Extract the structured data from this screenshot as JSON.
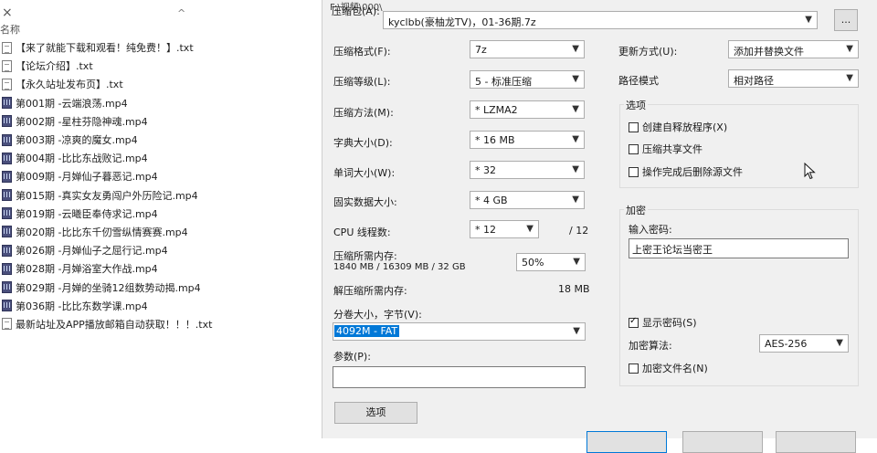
{
  "explorer": {
    "close_glyph": "×",
    "up_glyph": "^",
    "column_header": "名称",
    "files": [
      {
        "type": "txt",
        "name": "【来了就能下载和观看！纯免费！】.txt"
      },
      {
        "type": "txt",
        "name": "【论坛介绍】.txt"
      },
      {
        "type": "txt",
        "name": "【永久站址发布页】.txt"
      },
      {
        "type": "mp4",
        "name": "第001期 -云端浪荡.mp4"
      },
      {
        "type": "mp4",
        "name": "第002期 -星柱芬隐神魂.mp4"
      },
      {
        "type": "mp4",
        "name": "第003期 -凉爽的魔女.mp4"
      },
      {
        "type": "mp4",
        "name": "第004期 -比比东战败记.mp4"
      },
      {
        "type": "mp4",
        "name": "第009期 -月婵仙子暮恶记.mp4"
      },
      {
        "type": "mp4",
        "name": "第015期 -真实女友勇闯户外历险记.mp4"
      },
      {
        "type": "mp4",
        "name": "第019期 -云曦臣奉侍求记.mp4"
      },
      {
        "type": "mp4",
        "name": "第020期 -比比东千仞雪纵情赛赛.mp4"
      },
      {
        "type": "mp4",
        "name": "第026期 -月婵仙子之屈行记.mp4"
      },
      {
        "type": "mp4",
        "name": "第028期 -月婵浴室大作战.mp4"
      },
      {
        "type": "mp4",
        "name": "第029期 -月婵的坐骑12组数势动揭.mp4"
      },
      {
        "type": "mp4",
        "name": "第036期 -比比东数学课.mp4"
      },
      {
        "type": "txt",
        "name": "最新站址及APP播放邮箱自动获取！！！.txt"
      }
    ]
  },
  "dialog": {
    "archive_label": "压缩包(A):",
    "archive_path_hint": "F:\\视频\\000\\",
    "archive_name": "kyclbb(豪柚龙TV)，01-36期.7z",
    "browse_label": "...",
    "format": {
      "label": "压缩格式(F):",
      "value": "7z"
    },
    "level": {
      "label": "压缩等级(L):",
      "value": "5 - 标准压缩"
    },
    "method": {
      "label": "压缩方法(M):",
      "value": "* LZMA2"
    },
    "dict": {
      "label": "字典大小(D):",
      "value": "* 16 MB"
    },
    "word": {
      "label": "单词大小(W):",
      "value": "* 32"
    },
    "solid": {
      "label": "固实数据大小:",
      "value": "* 4 GB"
    },
    "cpu": {
      "label": "CPU 线程数:",
      "value": "* 12",
      "total": "/ 12"
    },
    "mem_comp": {
      "label": "压缩所需内存:",
      "detail": "1840 MB / 16309 MB / 32 GB",
      "percent": "50%"
    },
    "mem_decomp": {
      "label": "解压缩所需内存:",
      "value": "18 MB"
    },
    "split": {
      "label": "分卷大小，字节(V):",
      "value": "4092M - FAT"
    },
    "params": {
      "label": "参数(P):",
      "value": ""
    },
    "options_button": "选项",
    "update": {
      "label": "更新方式(U):",
      "value": "添加并替换文件"
    },
    "path": {
      "label": "路径模式",
      "value": "相对路径"
    },
    "options_group": {
      "title": "选项",
      "sfx": "创建自释放程序(X)",
      "shared": "压缩共享文件",
      "delete": "操作完成后删除源文件"
    },
    "encryption": {
      "title": "加密",
      "password_label": "输入密码:",
      "password": "上密王论坛当密王",
      "show_password": "显示密码(S)",
      "method_label": "加密算法:",
      "method_value": "AES-256",
      "encrypt_names": "加密文件名(N)"
    },
    "checks": {
      "sfx": false,
      "shared": false,
      "delete": false,
      "show_password": true,
      "encrypt_names": false
    }
  }
}
